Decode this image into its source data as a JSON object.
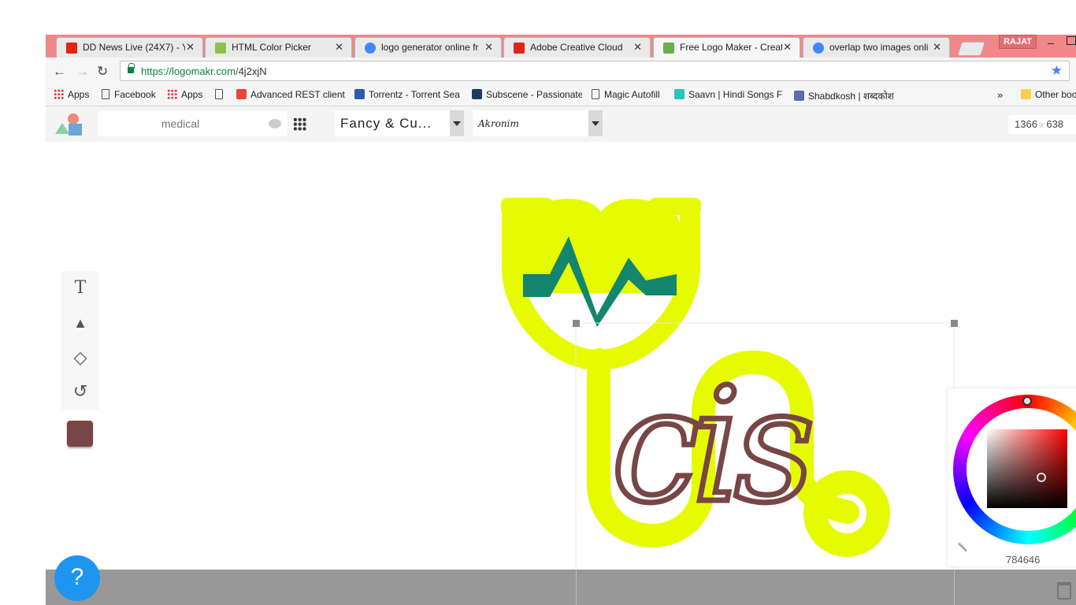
{
  "browser": {
    "tabs": [
      {
        "title": "DD News Live (24X7) - Y",
        "icon": "youtube-icon",
        "color": "#e62117",
        "active": false
      },
      {
        "title": "HTML Color Picker",
        "icon": "w3schools-icon",
        "color": "#8bc34a",
        "active": false
      },
      {
        "title": "logo generator online fr",
        "icon": "google-icon",
        "color": "#4285f4",
        "active": false
      },
      {
        "title": "Adobe Creative Cloud",
        "icon": "adobe-icon",
        "color": "#e1251b",
        "active": false
      },
      {
        "title": "Free Logo Maker - Creat",
        "icon": "logomakr-icon",
        "color": "#6ab04c",
        "active": true
      },
      {
        "title": "overlap two images onli",
        "icon": "google-icon",
        "color": "#4285f4",
        "active": false
      }
    ],
    "user": "RAJAT",
    "url_host": "https://logomakr.com/",
    "url_path": "4j2xjN",
    "bookmarks": [
      {
        "label": "Apps",
        "icon": "apps-icon"
      },
      {
        "label": "Facebook",
        "icon": "page-icon"
      },
      {
        "label": "Apps",
        "icon": "apps-icon"
      },
      {
        "label": "",
        "icon": "page-icon"
      },
      {
        "label": "Advanced REST client",
        "icon": "rest-client-icon"
      },
      {
        "label": "Torrentz - Torrent Sea",
        "icon": "torrentz-icon"
      },
      {
        "label": "Subscene - Passionate",
        "icon": "subscene-icon"
      },
      {
        "label": "Magic Autofill",
        "icon": "page-icon"
      },
      {
        "label": "Saavn | Hindi Songs F",
        "icon": "saavn-icon"
      },
      {
        "label": "Shabdkosh | शब्दकोश",
        "icon": "shabdkosh-icon"
      }
    ],
    "bookmarks_more": "»",
    "other_bookmarks": "Other boo"
  },
  "app": {
    "search_placeholder": "medical",
    "category_dropdown": "Fancy & Cu...",
    "font_dropdown": "Akronim",
    "canvas_width": "1366",
    "canvas_x": "x",
    "canvas_height": "638",
    "tools": [
      {
        "name": "text-tool",
        "glyph": "T"
      },
      {
        "name": "shape-tool",
        "glyph": "▲"
      },
      {
        "name": "fill-tool",
        "glyph": "◇"
      },
      {
        "name": "history-tool",
        "glyph": "↺"
      }
    ],
    "selected_color": "#784646",
    "help_label": "?",
    "colorpicker": {
      "hex": "784646",
      "hue": 0
    }
  },
  "artwork": {
    "text": "cis",
    "text_color": "#784646",
    "stethoscope_color": "#e6fb00",
    "pulse_color": "#12866e"
  }
}
